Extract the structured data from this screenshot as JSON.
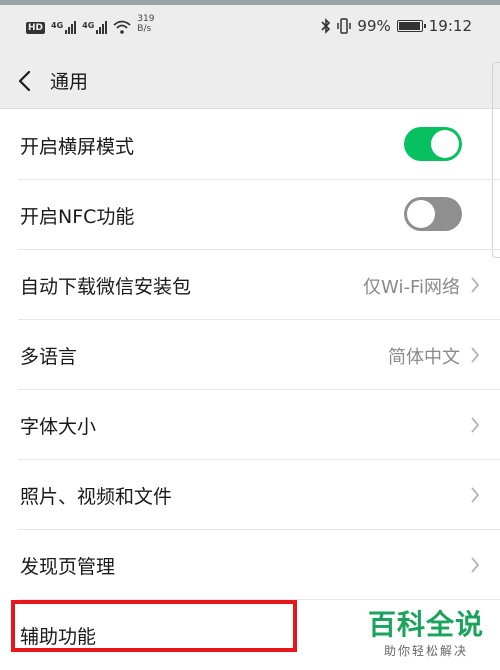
{
  "status_bar": {
    "hd": "HD",
    "network_1": "4G",
    "network_2": "4G",
    "speed_value": "319",
    "speed_unit": "B/s",
    "battery_percent": "99%",
    "battery_level": 0.99,
    "time": "19:12",
    "icons": [
      "signal-icon",
      "wifi-icon",
      "bluetooth-icon",
      "vibrate-icon",
      "battery-icon"
    ]
  },
  "navbar": {
    "back_icon": "chevron-left-icon",
    "title": "通用"
  },
  "settings": {
    "items": [
      {
        "label": "开启横屏模式",
        "type": "toggle",
        "on": true
      },
      {
        "label": "开启NFC功能",
        "type": "toggle",
        "on": false
      },
      {
        "label": "自动下载微信安装包",
        "type": "link",
        "value": "仅Wi-Fi网络"
      },
      {
        "label": "多语言",
        "type": "link",
        "value": "简体中文"
      },
      {
        "label": "字体大小",
        "type": "link",
        "value": ""
      },
      {
        "label": "照片、视频和文件",
        "type": "link",
        "value": ""
      },
      {
        "label": "发现页管理",
        "type": "link",
        "value": ""
      },
      {
        "label": "辅助功能",
        "type": "link",
        "value": ""
      }
    ]
  },
  "highlight_color": "#e8161b",
  "toggle_on_color": "#07c160",
  "watermark": {
    "main": "百科全说",
    "sub": "助你轻松解决"
  }
}
